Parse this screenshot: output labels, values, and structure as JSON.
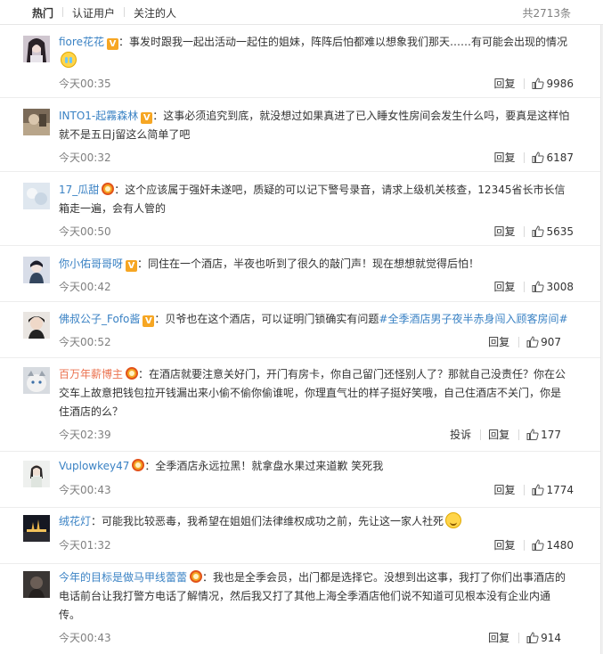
{
  "tabs": {
    "hot": "热门",
    "verified": "认证用户",
    "following": "关注的人"
  },
  "total": "共2713条",
  "actions": {
    "reply": "回复",
    "report": "投诉"
  },
  "colors": {
    "name_orange": "#eb7350",
    "name_blue": "#3a82c4",
    "badge_gold": "#f6a623"
  },
  "comments": [
    {
      "user": "fiore花花",
      "body": "事发时跟我一起出活动一起住的姐妹，阵阵后怕都难以想象我们那天……有可能会出现的情况",
      "time": "今天00:35",
      "likes": "9986",
      "badge": "v-badge-icon",
      "emoji": "cry-emoji"
    },
    {
      "user": "INTO1-起霧森林",
      "body": "这事必须追究到底，就没想过如果真进了已入睡女性房间会发生什么吗，要真是这样怕就不是五日j留这么简单了吧",
      "time": "今天00:32",
      "likes": "6187",
      "badge": "v-badge-icon"
    },
    {
      "user": "17_瓜甜",
      "body": "这个应该属于强奸未遂吧，质疑的可以记下警号录音，请求上级机关核查，12345省长市长信箱走一遍，会有人管的",
      "time": "今天00:50",
      "likes": "5635",
      "badge": "crown-badge-icon"
    },
    {
      "user": "你小佑哥哥呀",
      "body": "同住在一个酒店，半夜也听到了很久的敲门声！现在想想就觉得后怕！",
      "time": "今天00:42",
      "likes": "3008",
      "badge": "v-badge-icon"
    },
    {
      "user": "佛叔公子_Fofo酱",
      "body": "贝爷也在这个酒店，可以证明门锁确实有问题",
      "hashtag": "#全季酒店男子夜半赤身闯入顾客房间#",
      "time": "今天00:52",
      "likes": "907",
      "badge": "v-badge-icon"
    },
    {
      "user": "百万年薪博主",
      "body": "在酒店就要注意关好门，开门有房卡，你自己留门还怪别人了？那就自己没责任？你在公交车上故意把钱包拉开钱漏出来小偷不偷你偷谁呢，你理直气壮的样子挺好笑哦，自己住酒店不关门，你是住酒店的么？",
      "time": "今天02:39",
      "likes": "177",
      "badge": "crown-badge-icon",
      "report": true
    },
    {
      "user": "Vuplowkey47",
      "body": "全季酒店永远拉黑！就拿盘水果过来道歉 笑死我",
      "time": "今天00:43",
      "likes": "1774",
      "badge": "crown-badge-icon"
    },
    {
      "user": "绒花灯",
      "body": "可能我比较恶毒，我希望在姐姐们法律维权成功之前，先让这一家人社死",
      "time": "今天01:32",
      "likes": "1480",
      "emoji": "smile-emoji"
    },
    {
      "user": "今年的目标是做马甲线蕾蕾",
      "body": "我也是全季会员，出门都是选择它。没想到出这事，我打了你们出事酒店的电话前台让我打警方电话了解情况，然后我又打了其他上海全季酒店他们说不知道可见根本没有企业内通传。",
      "time": "今天00:43",
      "likes": "914",
      "badge": "crown-badge-icon"
    }
  ]
}
